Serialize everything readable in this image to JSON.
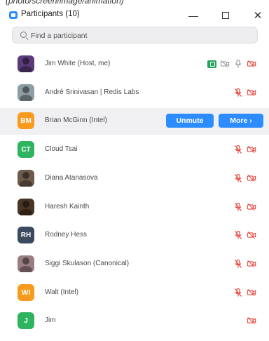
{
  "top_text": "(photo/screen/image/animation)",
  "window": {
    "title": "Participants (10)",
    "minimize": "—",
    "close": "✕"
  },
  "search": {
    "placeholder": "Find a participant"
  },
  "participants": [
    {
      "name": "Jim White (Host, me)",
      "avatar": {
        "type": "photo",
        "color": "#5b3b7a"
      },
      "icons": [
        "share-screen",
        "video-off",
        "mic-on",
        "video-off"
      ]
    },
    {
      "name": "André Srinivasan | Redis Labs",
      "avatar": {
        "type": "photo",
        "color": "#8e9ea6"
      },
      "icons": [
        "mic-muted",
        "video-off"
      ]
    },
    {
      "name": "Brian McGinn (Intel)",
      "avatar": {
        "type": "initials",
        "initials": "BM",
        "color": "#f79b1e"
      },
      "actions": {
        "unmute": "Unmute",
        "more": "More ›"
      }
    },
    {
      "name": "Cloud Tsai",
      "avatar": {
        "type": "initials",
        "initials": "CT",
        "color": "#2eb35f"
      },
      "icons": [
        "mic-muted",
        "video-off"
      ]
    },
    {
      "name": "Diana Atanasova",
      "avatar": {
        "type": "photo",
        "color": "#6d5a4a"
      },
      "icons": [
        "mic-muted",
        "video-off"
      ]
    },
    {
      "name": "Haresh Kainth",
      "avatar": {
        "type": "photo",
        "color": "#4a3424"
      },
      "icons": [
        "mic-muted",
        "video-off"
      ]
    },
    {
      "name": "Rodney Hess",
      "avatar": {
        "type": "initials",
        "initials": "RH",
        "color": "#3b4a5e"
      },
      "icons": [
        "mic-muted",
        "video-off"
      ]
    },
    {
      "name": "Siggi Skulason (Canonical)",
      "avatar": {
        "type": "photo",
        "color": "#9a7e80"
      },
      "icons": [
        "mic-muted",
        "video-off"
      ]
    },
    {
      "name": "Walt (Intel)",
      "avatar": {
        "type": "initials",
        "initials": "WI",
        "color": "#f79b1e"
      },
      "icons": [
        "mic-muted",
        "video-off"
      ]
    },
    {
      "name": "Jim",
      "avatar": {
        "type": "initials",
        "initials": "J",
        "color": "#2eb35f"
      },
      "icons": [
        "video-off"
      ]
    }
  ],
  "colors": {
    "accent": "#2d8cff",
    "muted_red": "#e8453c",
    "icon_gray": "#9a9a9a",
    "share_green": "#23a55a"
  }
}
